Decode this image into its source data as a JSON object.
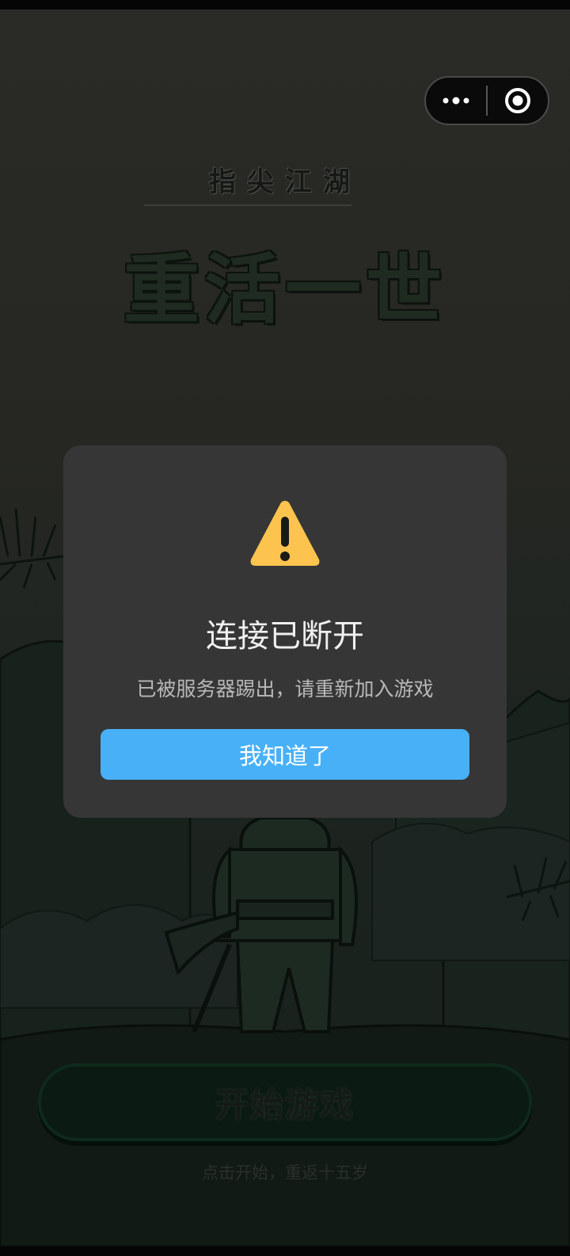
{
  "game": {
    "subtitle": "指尖江湖",
    "title": "重活一世",
    "start_button": "开始游戏",
    "start_hint": "点击开始，重返十五岁"
  },
  "capsule": {
    "more_icon": "more-dots-icon",
    "close_icon": "target-circle-icon"
  },
  "dialog": {
    "icon": "warning-triangle-icon",
    "title": "连接已断开",
    "message": "已被服务器踢出，请重新加入游戏",
    "confirm_label": "我知道了"
  },
  "colors": {
    "accent": "#48b0f7",
    "warning": "#fcc44e",
    "dialog_bg": "#363636"
  }
}
